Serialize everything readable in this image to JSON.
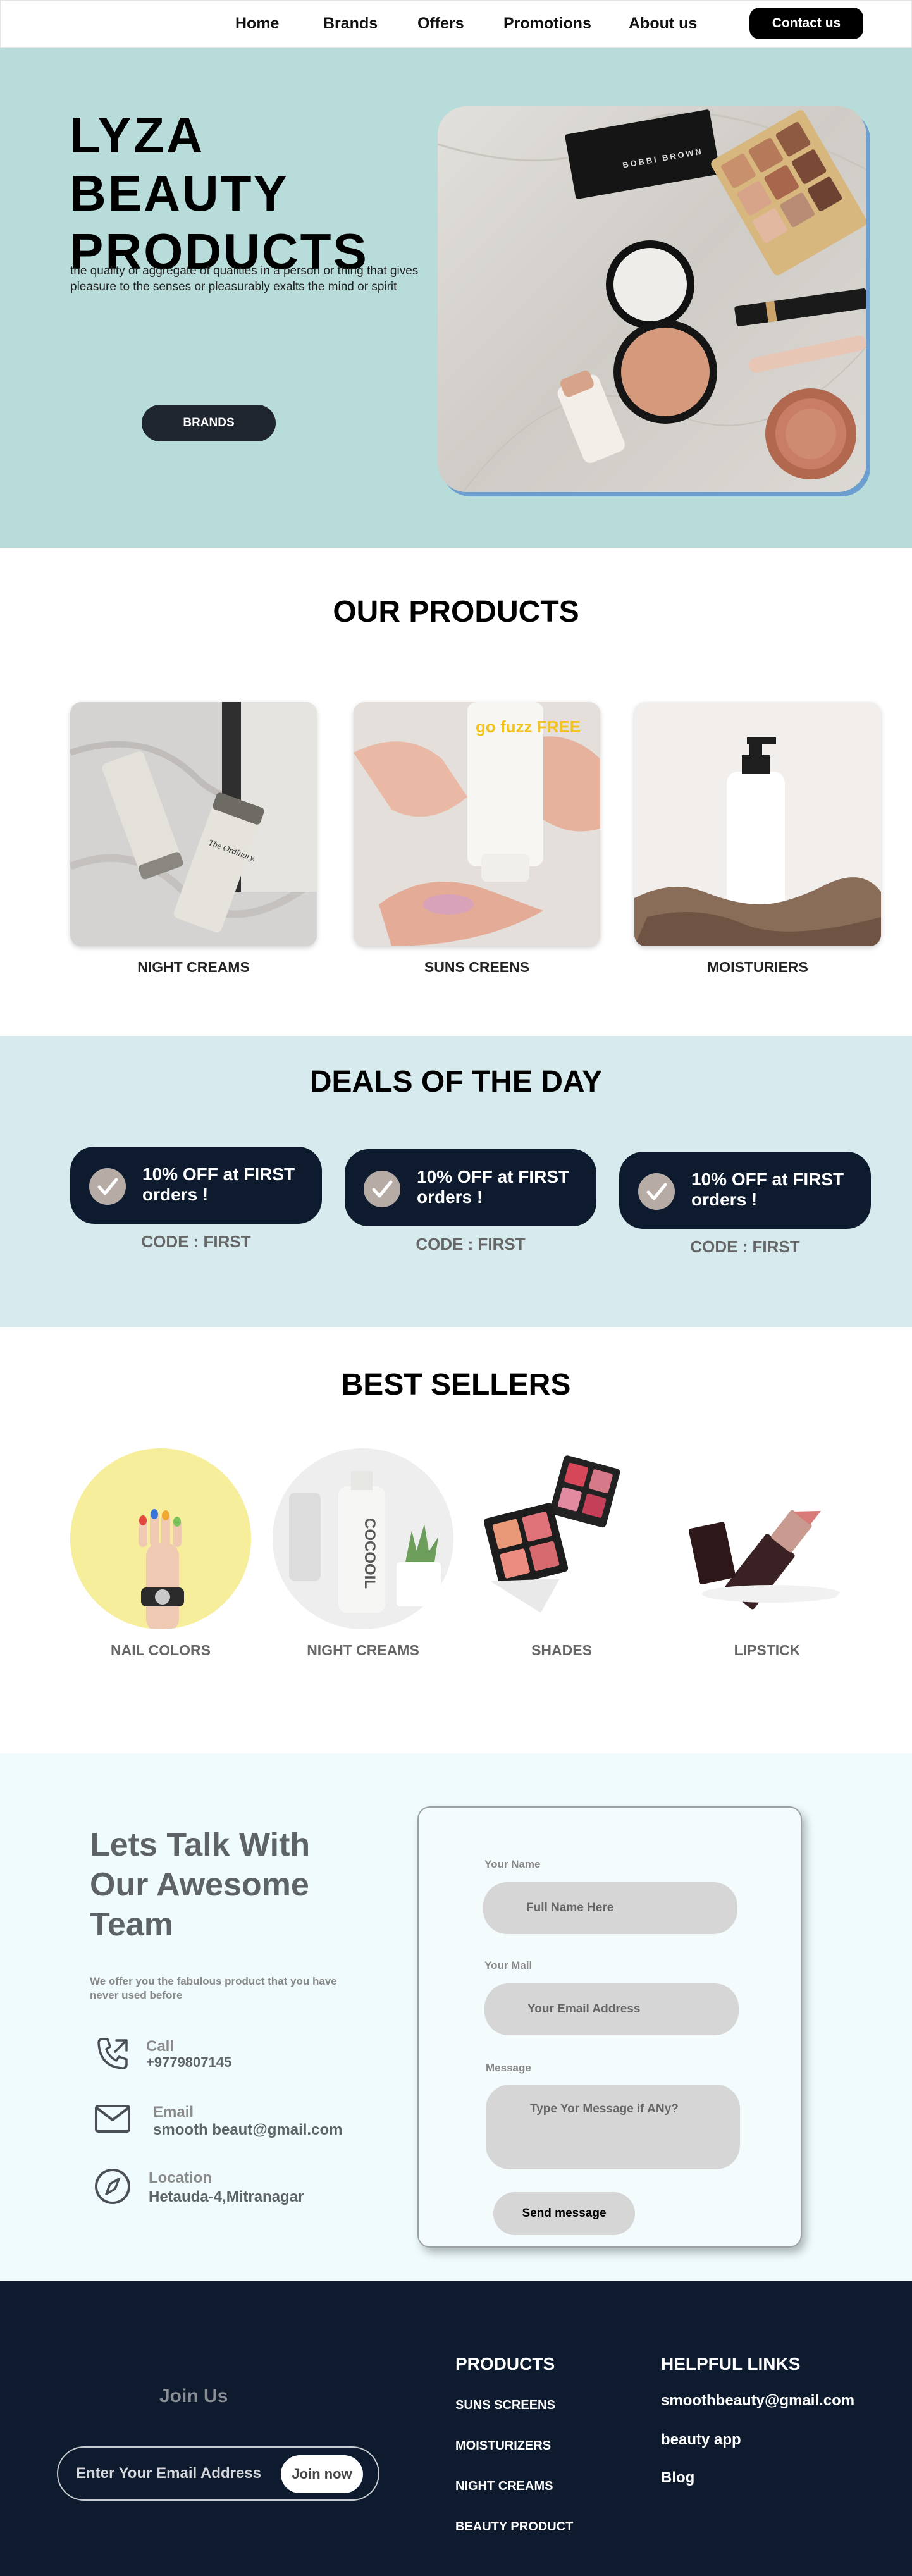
{
  "nav": {
    "links": [
      "Home",
      "Brands",
      "Offers",
      "Promotions",
      "About us"
    ],
    "contact_label": "Contact us"
  },
  "hero": {
    "title": "LYZA  BEAUTY PRODUCTS",
    "description": "the quality or aggregate of qualities in a person or thing that gives pleasure to the senses or pleasurably exalts the mind or spirit",
    "button_label": "BRANDS",
    "compact_brand": "BOBBI BROWN",
    "lipstick_brand": "BOBBI BROWN"
  },
  "products": {
    "title": "OUR PRODUCTS",
    "items": [
      {
        "label": "NIGHT CREAMS",
        "tube_brand": "The Ordinary."
      },
      {
        "label": "SUNS CREENS",
        "tube_text": "go fuzz FREE"
      },
      {
        "label": "MOISTURIERS"
      }
    ]
  },
  "deals": {
    "title": "DEALS OF THE DAY",
    "items": [
      {
        "text": "10% OFF at FIRST orders !",
        "code": "CODE : FIRST"
      },
      {
        "text": "10% OFF at FIRST orders !",
        "code": "CODE : FIRST"
      },
      {
        "text": "10% OFF at FIRST orders !",
        "code": "CODE : FIRST"
      }
    ]
  },
  "best_sellers": {
    "title": "BEST SELLERS",
    "items": [
      {
        "label": "NAIL COLORS"
      },
      {
        "label": "NIGHT CREAMS",
        "bottle_text": "COCOOIL"
      },
      {
        "label": "SHADES"
      },
      {
        "label": "LIPSTICK"
      }
    ]
  },
  "contact": {
    "title": "Lets Talk With Our Awesome Team",
    "subtitle": "We offer you the fabulous product that you have never used before",
    "call_label": "Call",
    "call_value": "+9779807145",
    "email_label": "Email",
    "email_value": "smooth beaut@gmail.com",
    "location_label": "Location",
    "location_value": "Hetauda-4,Mitranagar",
    "form": {
      "name_label": "Your Name",
      "name_placeholder": "Full Name Here",
      "mail_label": "Your Mail",
      "mail_placeholder": "Your Email Address",
      "message_label": "Message",
      "message_placeholder": "Type Yor Message if ANy?",
      "send_label": "Send message"
    }
  },
  "footer": {
    "join_title": "Join Us",
    "join_placeholder": "Enter Your Email Address",
    "join_button": "Join now",
    "products_heading": "PRODUCTS",
    "products_links": [
      "SUNS SCREENS",
      "MOISTURIZERS",
      "NIGHT CREAMS",
      "BEAUTY PRODUCT"
    ],
    "helpful_heading": "HELPFUL LINKS",
    "helpful_links": [
      "smoothbeauty@gmail.com",
      "beauty app",
      "Blog"
    ]
  },
  "colors": {
    "hero_bg": "#b7dcda",
    "deals_bg": "#d7ebee",
    "contact_bg": "#effbfc",
    "footer_bg": "#0e1b2e",
    "accent_dark": "#0e1b2e"
  },
  "icons": [
    "check-icon",
    "phone-icon",
    "mail-icon",
    "compass-icon"
  ]
}
